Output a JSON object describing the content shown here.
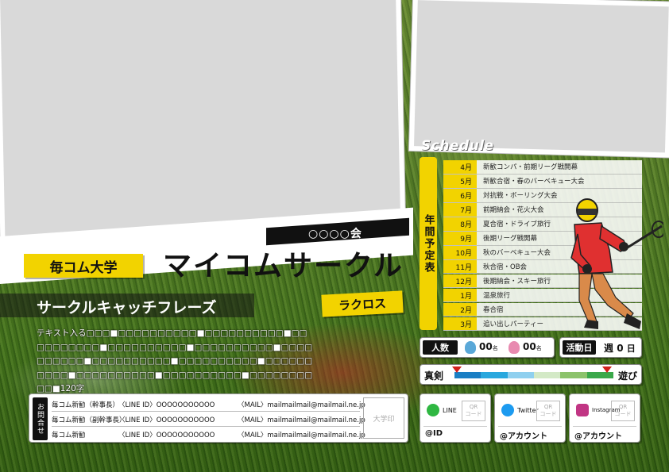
{
  "header": {
    "circle_kai": "○○○○会",
    "university": "毎コム大学",
    "circle_name": "マイコムサークル",
    "sport_badge": "ラクロス",
    "catch_phrase": "サークルキャッチフレーズ",
    "body_text": "テキスト入る□□□■□□□□□□□□□□■□□□□□□□□□□■□□□□□□□□□□■□□□□□□□□□□■□□□□□□□□□□■□□□□□□□□□□■□□□□□□□□□□■□□□□□□□□□□■□□□□□□□□□□■□□□□□□□□□□■□□□□□□□□□□■□□□□□□□□□□■120字"
  },
  "schedule": {
    "title": "Schedule",
    "vertical_label": "年間予定表",
    "rows": [
      {
        "month": "4月",
        "event": "新歓コンパ・前期リーグ戦開幕"
      },
      {
        "month": "5月",
        "event": "新歓合宿・春のバーベキュー大会"
      },
      {
        "month": "6月",
        "event": "対抗戦・ボーリング大会"
      },
      {
        "month": "7月",
        "event": "前期納会・花火大会"
      },
      {
        "month": "8月",
        "event": "夏合宿・ドライブ旅行"
      },
      {
        "month": "9月",
        "event": "後期リーグ戦開幕"
      },
      {
        "month": "10月",
        "event": "秋のバーベキュー大会"
      },
      {
        "month": "11月",
        "event": "秋合宿・OB会"
      },
      {
        "month": "12月",
        "event": "後期納会・スキー旅行"
      },
      {
        "month": "1月",
        "event": "温泉旅行"
      },
      {
        "month": "2月",
        "event": "春合宿"
      },
      {
        "month": "3月",
        "event": "追い出しパーティー"
      }
    ]
  },
  "members": {
    "label": "人数",
    "male": "00",
    "female": "00",
    "unit": "名"
  },
  "activity": {
    "label": "活動日",
    "prefix": "週",
    "days": "0",
    "unit": "日"
  },
  "scale": {
    "left": "真剣",
    "right": "遊び"
  },
  "contact": {
    "label": "お問合せ",
    "rows": [
      {
        "role": "毎コム新勧（幹事長）",
        "line": "〈LINE ID〉OOOOOOOOOOO",
        "mail": "〈MAIL〉mailmailmail@mailmail.ne.jp"
      },
      {
        "role": "毎コム新勧（副幹事長）",
        "line": "〈LINE ID〉OOOOOOOOOOO",
        "mail": "〈MAIL〉mailmailmail@mailmail.ne.jp"
      },
      {
        "role": "毎コム新勧",
        "line": "〈LINE ID〉OOOOOOOOOOO",
        "mail": "〈MAIL〉mailmailmail@mailmail.ne.jp"
      }
    ],
    "seal": "大学印"
  },
  "sns": [
    {
      "name": "LINE",
      "account": "@ID",
      "qr": "QR\nコード",
      "icon": "line-icon",
      "color": "#2fb742"
    },
    {
      "name": "Twitter",
      "account": "@アカウント",
      "qr": "QR\nコード",
      "icon": "twitter-icon",
      "color": "#1d9bf0"
    },
    {
      "name": "Instagram",
      "account": "@アカウント",
      "qr": "QR\nコード",
      "icon": "instagram-icon",
      "color": "#c13584"
    }
  ]
}
